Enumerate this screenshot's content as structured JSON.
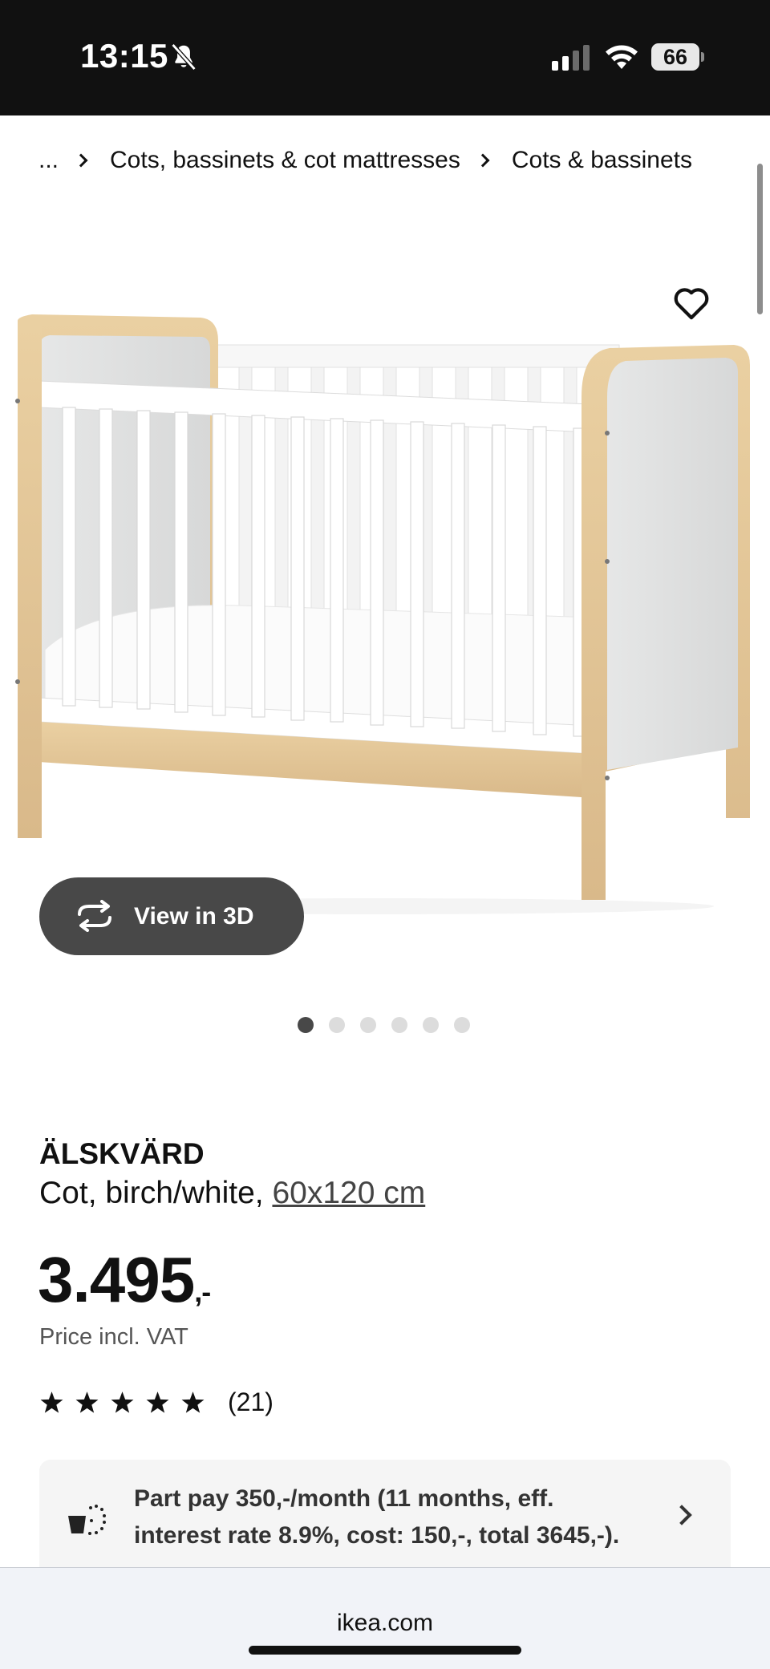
{
  "status_bar": {
    "time": "13:15",
    "battery": "66",
    "icons": [
      "bell-slash-icon",
      "signal-icon",
      "wifi-icon",
      "battery-icon"
    ]
  },
  "breadcrumb": {
    "ellipsis": "...",
    "items": [
      "Cots, bassinets & cot mattresses",
      "Cots & bassinets"
    ]
  },
  "gallery": {
    "view_3d_label": "View in 3D",
    "dot_count": 6,
    "active_dot": 0
  },
  "product": {
    "name": "ÄLSKVÄRD",
    "description": "Cot, birch/white,",
    "size": "60x120 cm",
    "price": "3.495",
    "price_suffix": ",-",
    "price_note": "Price incl. VAT",
    "rating": 5,
    "rating_count": "(21)"
  },
  "partpay": {
    "text": "Part pay 350,-/month (11 months, eff. interest rate 8.9%, cost: 150,-, total 3645,-)."
  },
  "browser": {
    "url": "ikea.com"
  },
  "colors": {
    "status_bar_bg": "#111111",
    "button_dark": "#484848",
    "birch": "#e3c697",
    "panel_grey": "#dfe0e0"
  }
}
